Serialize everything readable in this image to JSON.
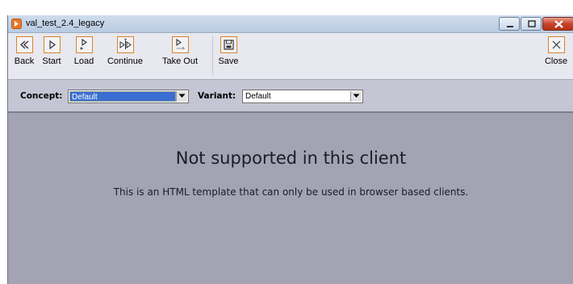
{
  "window": {
    "title": "val_test_2.4_legacy"
  },
  "toolbar": {
    "back_label": "Back",
    "start_label": "Start",
    "load_label": "Load",
    "continue_label": "Continue",
    "takeout_label": "Take Out",
    "save_label": "Save",
    "close_label": "Close"
  },
  "concept": {
    "label": "Concept:",
    "value": "Default"
  },
  "variant": {
    "label": "Variant:",
    "value": "Default"
  },
  "content": {
    "title": "Not supported in this client",
    "message": "This is an HTML template that can only be used in browser based clients."
  },
  "colors": {
    "accent": "#d98426",
    "background": "#a3a3b4",
    "selection": "#3a6ed0"
  }
}
